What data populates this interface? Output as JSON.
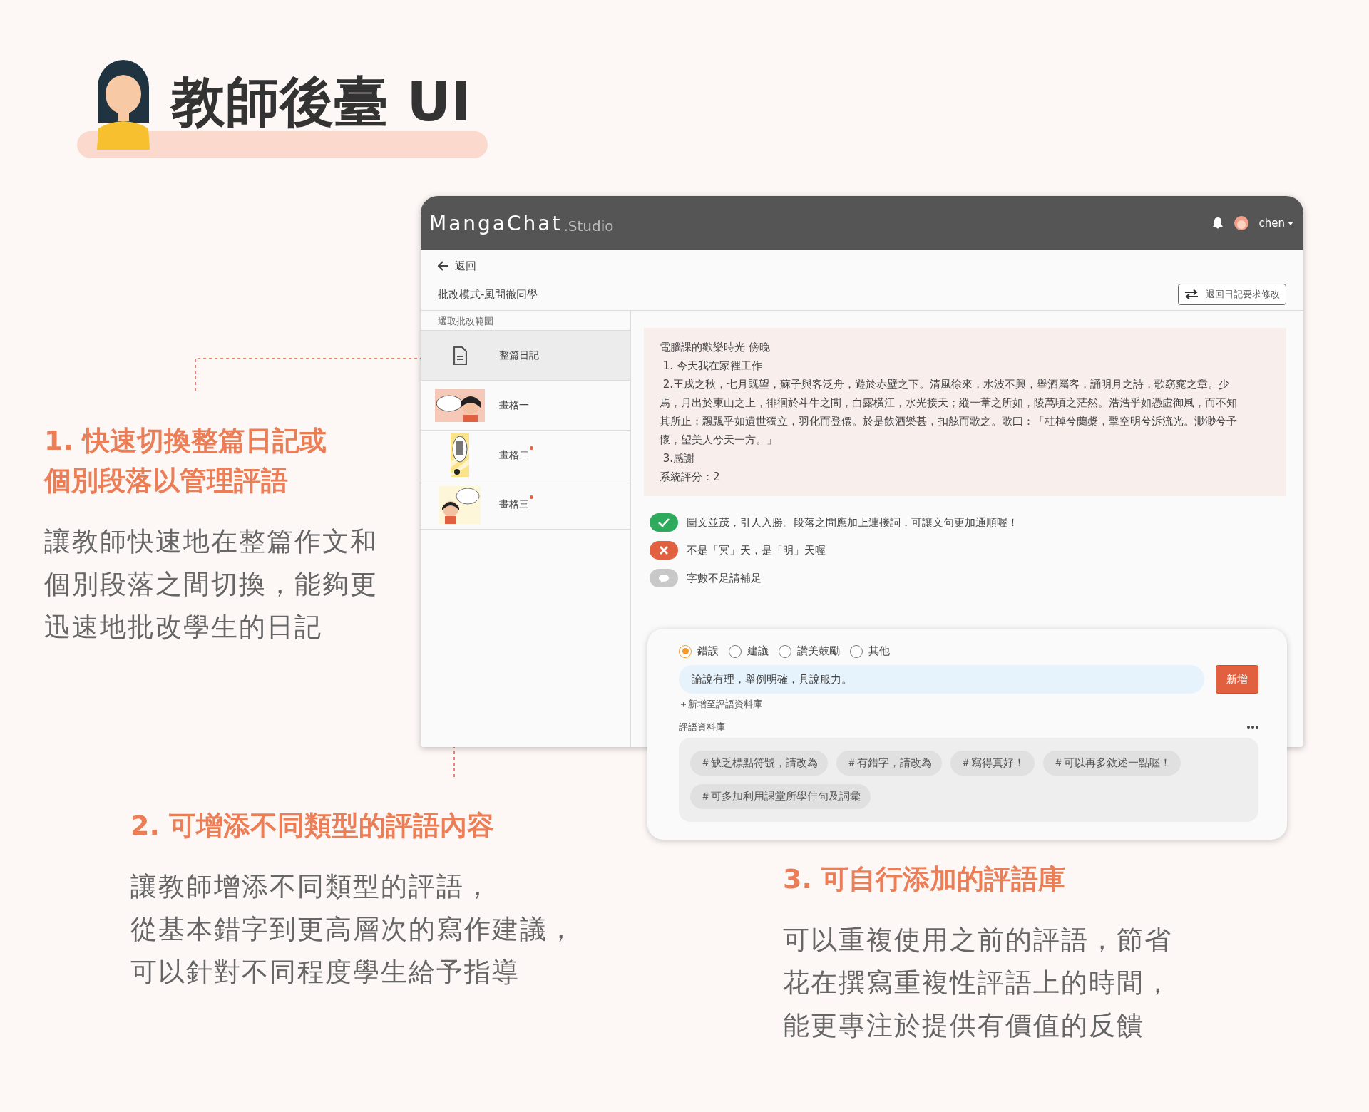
{
  "title": {
    "text": "教師後臺 UI"
  },
  "sections": [
    {
      "heading_lines": [
        "1. 快速切換整篇日記或",
        "個別段落以管理評語"
      ],
      "body_lines": [
        "讓教師快速地在整篇作文和",
        "個別段落之間切換，能夠更",
        "迅速地批改學生的日記"
      ]
    },
    {
      "heading_lines": [
        "2. 可增添不同類型的評語內容"
      ],
      "body_lines": [
        "讓教師增添不同類型的評語，",
        "從基本錯字到更高層次的寫作建議，",
        "可以針對不同程度學生給予指導"
      ]
    },
    {
      "heading_lines": [
        "3. 可自行添加的評語庫"
      ],
      "body_lines": [
        "可以重複使用之前的評語，節省",
        "花在撰寫重複性評語上的時間，",
        "能更專注於提供有價值的反饋"
      ]
    }
  ],
  "app": {
    "brand": "MangaChat",
    "brand_suffix": ".Studio",
    "user": "chen",
    "back": "返回",
    "page_title": "批改模式-風間徹同學",
    "return_button": "退回日記要求修改",
    "range_label": "選取批改範圍",
    "items": [
      {
        "kind": "document",
        "label": "整篇日記",
        "selected": true,
        "has_note": false
      },
      {
        "kind": "panel",
        "label": "畫格一",
        "selected": false,
        "has_note": false
      },
      {
        "kind": "panel",
        "label": "畫格二",
        "selected": false,
        "has_note": true
      },
      {
        "kind": "panel",
        "label": "畫格三",
        "selected": false,
        "has_note": true
      }
    ],
    "diary_lines": [
      "電腦課的歡樂時光 傍晚",
      " 1. 今天我在家裡工作",
      " 2.王戌之秋，七月既望，蘇子與客泛舟，遊於赤壁之下。清風徐來，水波不興，舉酒屬客，誦明月之詩，歌窈窕之章。少",
      "焉，月出於東山之上，徘徊於斗牛之間，白露橫江，水光接天；縱一葦之所如，陵萬頃之茫然。浩浩乎如憑虛御風，而不知",
      "其所止；飄飄乎如遺世獨立，羽化而登僊。於是飲酒樂甚，扣舷而歌之。歌曰：「桂棹兮蘭槳，擊空明兮泝流光。渺渺兮予",
      "懷，望美人兮天一方。」",
      " 3.感謝",
      "系統評分：2"
    ],
    "comments": [
      {
        "kind": "good",
        "text": "圖文並茂，引人入勝。段落之間應加上連接詞，可讓文句更加通順喔！"
      },
      {
        "kind": "error",
        "text": "不是「冥」天，是「明」天喔"
      },
      {
        "kind": "note",
        "text": "字數不足請補足"
      }
    ]
  },
  "editor": {
    "types": [
      {
        "label": "錯誤",
        "selected": true
      },
      {
        "label": "建議",
        "selected": false
      },
      {
        "label": "讚美鼓勵",
        "selected": false
      },
      {
        "label": "其他",
        "selected": false
      }
    ],
    "input_value": "論說有理，舉例明確，具說服力。",
    "add_button": "新增",
    "add_to_library": "＋新增至評語資料庫",
    "library_label": "評語資料庫",
    "tags": [
      "＃缺乏標點符號，請改為",
      "＃有錯字，請改為",
      "＃寫得真好！",
      "＃可以再多敘述一點喔！",
      "＃可多加利用課堂所學佳句及詞彙"
    ]
  }
}
